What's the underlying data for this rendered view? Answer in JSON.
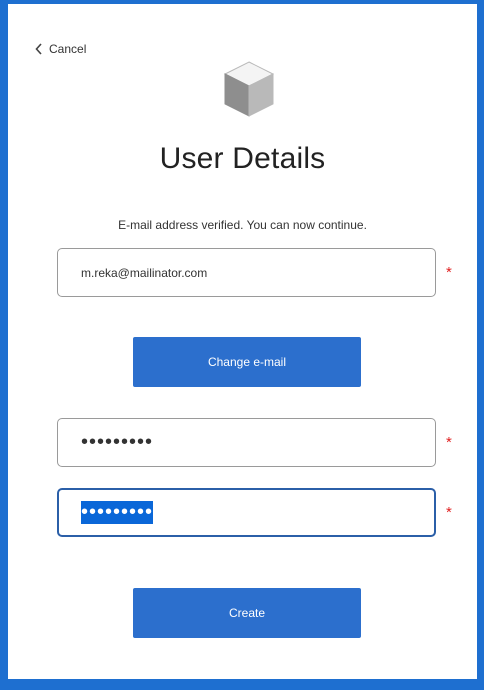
{
  "nav": {
    "cancel_label": "Cancel"
  },
  "header": {
    "logo_icon": "cube-icon",
    "title": "User Details"
  },
  "form": {
    "message": "E-mail address verified. You can now continue.",
    "email": {
      "value": "m.reka@mailinator.com",
      "required_marker": "*"
    },
    "change_email_label": "Change e-mail",
    "password": {
      "value": "•••••••••",
      "required_marker": "*"
    },
    "confirm_password": {
      "value": "•••••••••",
      "required_marker": "*"
    },
    "create_label": "Create"
  },
  "colors": {
    "background": "#1e6fd0",
    "button": "#2c6fcd",
    "required": "#e02020",
    "focus_border": "#2b5fa8"
  }
}
